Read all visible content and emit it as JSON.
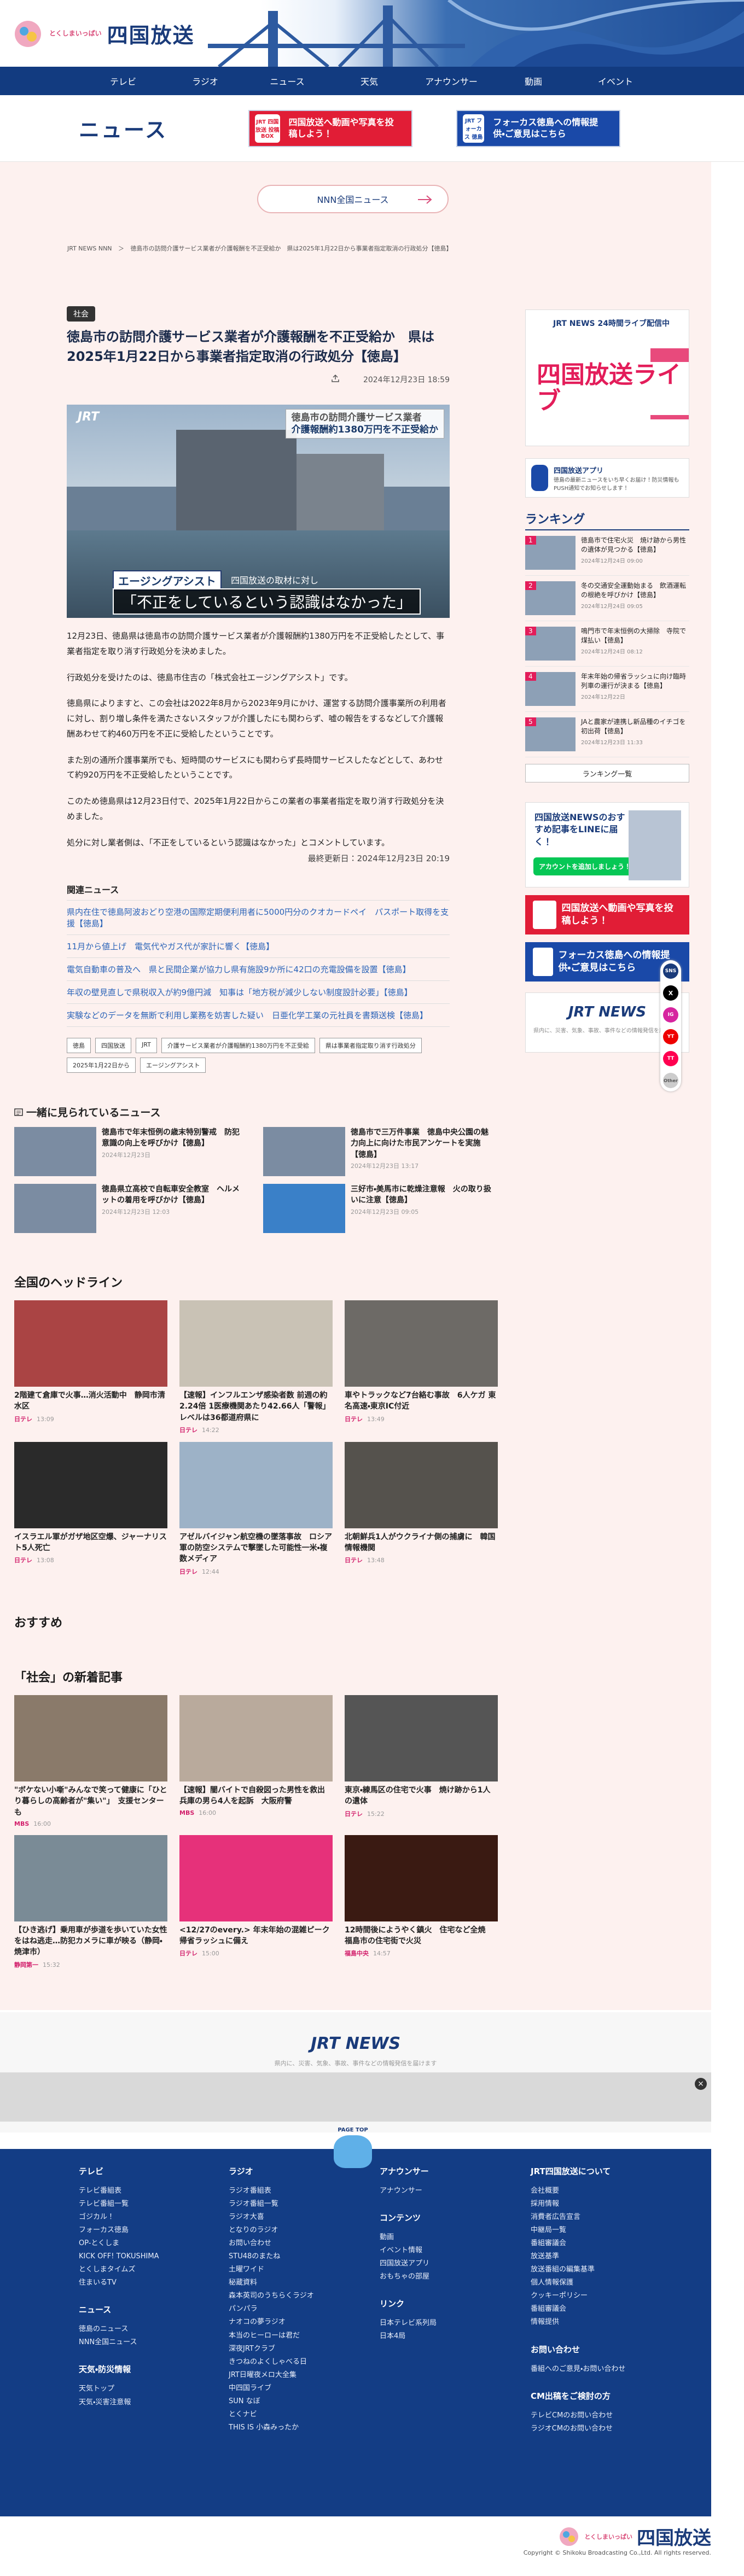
{
  "header": {
    "tagline": "とくしまいっぱい",
    "station": "四国放送"
  },
  "gnav": [
    "テレビ",
    "ラジオ",
    "ニュース",
    "天気",
    "アナウンサー",
    "動画",
    "イベント"
  ],
  "sub": {
    "title": "ニュース",
    "banner1": "四国放送へ動画や写真を投稿しよう！",
    "banner1_icon": "JRT 四国放送 投稿BOX",
    "banner2": "フォーカス徳島への情報提供・ご意見はこちら",
    "banner2_icon": "JRT フォーカス 徳島"
  },
  "nnn_button": "NNN全国ニュース",
  "breadcrumb": [
    "JRT NEWS NNN",
    "＞",
    "徳島市の訪問介護サービス業者が介護報酬を不正受給か　県は2025年1月22日から事業者指定取消の行政処分【徳島】"
  ],
  "article": {
    "category": "社会",
    "title": "徳島市の訪問介護サービス業者が介護報酬を不正受給か　県は2025年1月22日から事業者指定取消の行政処分【徳島】",
    "published": "2024年12月23日 18:59",
    "image": {
      "logo": "JRT",
      "title1": "徳島市の訪問介護サービス業者",
      "title2": "介護報酬約1380万円を不正受給か",
      "name": "エージングアシスト",
      "sub": "四国放送の取材に対し",
      "quote": "「不正をしているという認識はなかった」"
    },
    "p1": "12月23日、徳島県は徳島市の訪問介護サービス業者が介護報酬約1380万円を不正受給したとして、事業者指定を取り消す行政処分を決めました。",
    "p2": "行政処分を受けたのは、徳島市住吉の「株式会社エージングアシスト」です。",
    "p3": "徳島県によりますと、この会社は2022年8月から2023年9月にかけ、運営する訪問介護事業所の利用者に対し、割り増し条件を満たさないスタッフが介護したにも関わらず、嘘の報告をするなどして介護報酬あわせて約460万円を不正に受給したということです。",
    "p4": "また別の通所介護事業所でも、短時間のサービスにも関わらず長時間サービスしたなどとして、あわせて約920万円を不正受給したということです。",
    "p5": "このため徳島県は12月23日付で、2025年1月22日からこの業者の事業者指定を取り消す行政処分を決めました。",
    "p6": "処分に対し業者側は、「不正をしているという認識はなかった」とコメントしています。",
    "updated": "最終更新日：2024年12月23日 20:19",
    "related_title": "関連ニュース",
    "related": [
      "県内在住で徳島阿波おどり空港の国際定期便利用者に5000円分のクオカードペイ　パスポート取得を支援【徳島】",
      "11月から値上げ　電気代やガス代が家計に響く【徳島】",
      "電気自動車の普及へ　県と民間企業が協力し県有施設9か所に42口の充電設備を設置【徳島】",
      "年収の壁見直しで県税収入が約9億円減　知事は「地方税が減少しない制度設計必要」【徳島】",
      "実験などのデータを無断で利用し業務を妨害した疑い　日亜化学工業の元社員を書類送検【徳島】"
    ],
    "tags": [
      "徳島",
      "四国放送",
      "JRT",
      "介護サービス業者が介護報酬約1380万円を不正受給",
      "県は事業者指定取り消す行政処分",
      "2025年1月22日から",
      "エージングアシスト"
    ]
  },
  "sidebar": {
    "live_top": "JRT NEWS 24時間ライブ配信中",
    "live_big": "四国放送ライブ",
    "app_title": "四国放送アプリ",
    "app_desc": "徳島の最新ニュースをいち早くお届け！防災情報もPUSH通知でお知らせします！",
    "ranking_title": "ランキング",
    "ranking": [
      {
        "n": "1",
        "t": "徳島市で住宅火災　焼け跡から男性の遺体が見つかる【徳島】",
        "d": "2024年12月24日 09:00"
      },
      {
        "n": "2",
        "t": "冬の交通安全運動始まる　飲酒運転の根絶を呼びかけ【徳島】",
        "d": "2024年12月24日 09:05"
      },
      {
        "n": "3",
        "t": "鳴門市で年末恒例の大掃除　寺院で煤払い【徳島】",
        "d": "2024年12月24日 08:12"
      },
      {
        "n": "4",
        "t": "年末年始の帰省ラッシュに向け臨時列車の運行が決まる【徳島】",
        "d": "2024年12月22日"
      },
      {
        "n": "5",
        "t": "JAと農家が連携し新品種のイチゴを初出荷【徳島】",
        "d": "2024年12月23日 11:33"
      }
    ],
    "ranking_more": "ランキング一覧",
    "line_title": "四国放送NEWSのおすすめ記事をLINEに届く！",
    "line_btn": "アカウントを追加しましょう！",
    "bnr1": "四国放送へ動画や写真を投稿しよう！",
    "bnr2": "フォーカス徳島への情報提供・ご意見はこちら",
    "jrt_logo": "JRT NEWS",
    "jrt_desc": "県内に、災害、気象、事故、事件などの情報発信を届けます"
  },
  "sns": [
    "SNS",
    "X",
    "IG",
    "YT",
    "TT",
    "Other"
  ],
  "also": {
    "title": "一緒に見られているニュース",
    "items": [
      {
        "t": "徳島市で年末恒例の歳末特別警戒　防犯意識の向上を呼びかけ【徳島】",
        "d": "2024年12月23日"
      },
      {
        "t": "徳島市で三万件事業　徳島中央公園の魅力向上に向けた市民アンケートを実施【徳島】",
        "d": "2024年12月23日 13:17"
      },
      {
        "t": "徳島県立高校で自転車安全教室　ヘルメットの着用を呼びかけ【徳島】",
        "d": "2024年12月23日 12:03"
      },
      {
        "t": "三好市・美馬市に乾燥注意報　火の取り扱いに注意【徳島】",
        "d": "2024年12月23日 09:05"
      }
    ]
  },
  "headlines": {
    "title": "全国のヘッドライン",
    "items": [
      {
        "t": "2階建て倉庫で火事…消火活動中　静岡市清水区",
        "src": "日テレ",
        "d": "13:09"
      },
      {
        "t": "【速報】インフルエンザ感染者数 前週の約2.24倍 1医療機関あたり42.66人「警報」レベルは36都道府県に",
        "src": "日テレ",
        "d": "14:22"
      },
      {
        "t": "車やトラックなど7台絡む事故　6人ケガ 東名高速・東京IC付近",
        "src": "日テレ",
        "d": "13:49"
      },
      {
        "t": "イスラエル軍がガザ地区空爆、ジャーナリスト5人死亡",
        "src": "日テレ",
        "d": "13:08"
      },
      {
        "t": "アゼルバイジャン航空機の墜落事故　ロシア軍の防空システムで撃墜した可能性一米・複数メディア",
        "src": "日テレ",
        "d": "12:44"
      },
      {
        "t": "北朝鮮兵1人がウクライナ側の捕虜に　韓国情報機関",
        "src": "日テレ",
        "d": "13:48"
      }
    ]
  },
  "recommend": {
    "title": "おすすめ"
  },
  "society": {
    "title": "「社会」の新着記事",
    "items": [
      {
        "t": "\"ボケない小噺\"みんなで笑って健康に「ひとり暮らしの高齢者が\"集い\"」　支援センターも",
        "src": "MBS",
        "d": "16:00"
      },
      {
        "t": "【速報】闇バイトで自殺図った男性を救出　兵庫の男ら4人を起訴　大阪府警",
        "src": "MBS",
        "d": "16:00"
      },
      {
        "t": "東京・練馬区の住宅で火事　焼け跡から1人の遺体",
        "src": "日テレ",
        "d": "15:22"
      },
      {
        "t": "【ひき逃げ】乗用車が歩道を歩いていた女性をはね逃走…防犯カメラに車が映る（静岡・焼津市）",
        "src": "静岡第一",
        "d": "15:32"
      },
      {
        "t": "<12/27のevery.> 年末年始の混雑ピーク　帰省ラッシュに備え",
        "src": "日テレ",
        "d": "15:00"
      },
      {
        "t": "12時間後にようやく鎮火　住宅など全焼　福島市の住宅街で火災",
        "src": "福島中央",
        "d": "14:57"
      }
    ]
  },
  "footer_bar": {
    "logo": "JRT NEWS",
    "desc": "県内に、災害、気象、事故、事件などの情報発信を届けます"
  },
  "pagetop": "PAGE TOP",
  "footer": {
    "tv": {
      "h": "テレビ",
      "items": [
        "テレビ番組表",
        "テレビ番組一覧",
        "ゴジカル！",
        "フォーカス徳島",
        "OP-とくしま",
        "KICK OFF! TOKUSHIMA",
        "とくしまタイムズ",
        "住まいるTV"
      ]
    },
    "news": {
      "h": "ニュース",
      "items": [
        "徳島のニュース",
        "NNN全国ニュース"
      ]
    },
    "weather": {
      "h": "天気・防災情報",
      "items": [
        "天気トップ",
        "天気・災害注意報"
      ]
    },
    "radio": {
      "h": "ラジオ",
      "items": [
        "ラジオ番組表",
        "ラジオ番組一覧",
        "ラジオ大喜",
        "となりのラジオ",
        "お問い合わせ",
        "STU48のまたね",
        "土曜ワイド",
        "秘蔵資料",
        "森本英司のうちらくラジオ",
        "パンパラ",
        "ナオコの夢ラジオ",
        "本当のヒーローは君だ",
        "深夜JRTクラブ",
        "きつねのよくしゃべる日",
        "JRT日曜夜メロ大全集",
        "中四国ライブ",
        "SUN なぼ",
        "とくナビ",
        "THIS IS 小森みったか"
      ]
    },
    "ann": {
      "h": "アナウンサー",
      "items": [
        "アナウンサー"
      ]
    },
    "content": {
      "h": "コンテンツ",
      "items": [
        "動画",
        "イベント情報",
        "四国放送アプリ",
        "おもちゃの部屋"
      ]
    },
    "link": {
      "h": "リンク",
      "items": [
        "日本テレビ系列局",
        "日本4局"
      ]
    },
    "about": {
      "h": "JRT四国放送について",
      "items": [
        "会社概要",
        "採用情報",
        "消費者広告宣言",
        "中継局一覧",
        "番組審議会",
        "放送基準",
        "放送番組の編集基準",
        "個人情報保護",
        "クッキーポリシー",
        "番組審議会",
        "情報提供"
      ]
    },
    "contact": {
      "h": "お問い合わせ",
      "items": [
        "番組へのご意見・お問い合わせ"
      ]
    },
    "cm": {
      "h": "CM出稿をご検討の方",
      "items": [
        "テレビCMのお問い合わせ",
        "ラジオCMのお問い合わせ"
      ]
    }
  },
  "bottom": {
    "tagline": "とくしまいっぱい",
    "name": "四国放送",
    "copyright": "Copyright © Shikoku Broadcasting Co.,Ltd. All rights reserved."
  }
}
